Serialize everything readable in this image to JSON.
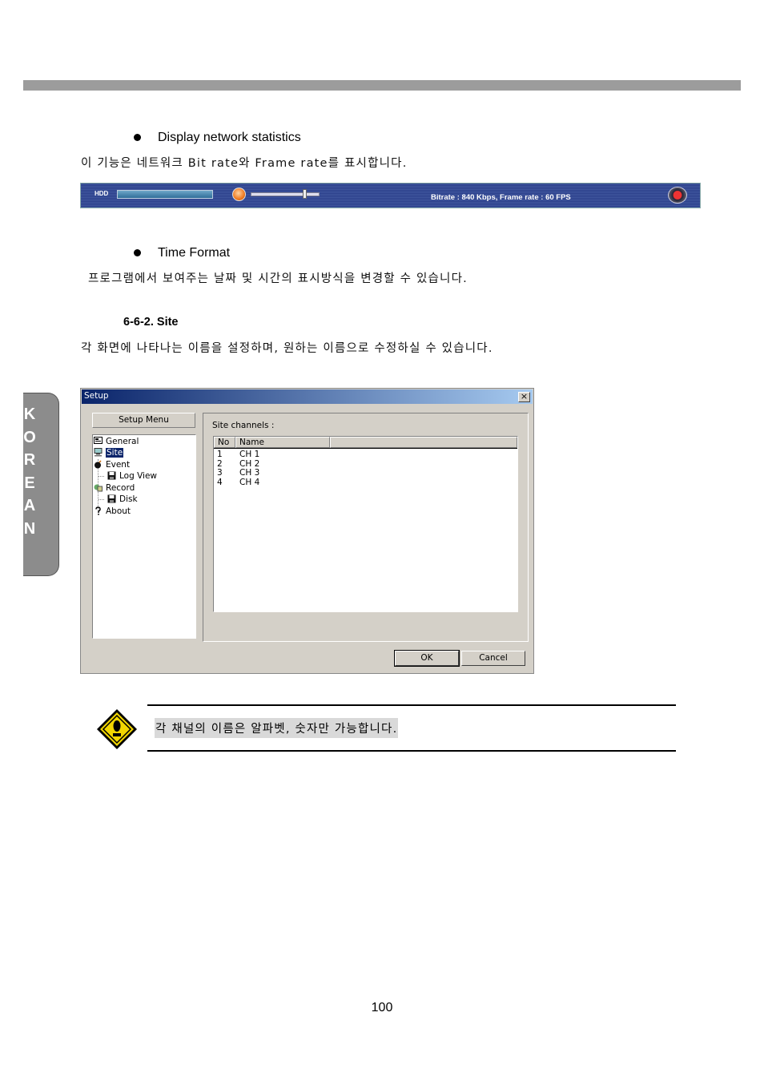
{
  "sections": {
    "network": {
      "title": "Display network statistics",
      "desc": "이 기능은 네트워크 Bit rate와 Frame rate를 표시합니다."
    },
    "statusbar": {
      "hdd_label": "HDD",
      "stats_text": "Bitrate : 840 Kbps, Frame rate : 60 FPS"
    },
    "time": {
      "title": "Time Format",
      "desc": "프로그램에서 보여주는 날짜 및 시간의 표시방식을 변경할 수 있습니다."
    },
    "site": {
      "heading": "6-6-2. Site",
      "desc": "각 화면에 나타나는 이름을 설정하며, 원하는 이름으로 수정하실 수 있습니다."
    }
  },
  "side_tab": [
    "K",
    "O",
    "R",
    "E",
    "A",
    "N"
  ],
  "dialog": {
    "title": "Setup",
    "close_glyph": "×",
    "menu_label": "Setup Menu",
    "tree": [
      "General",
      "Site",
      "Event",
      "Log View",
      "Record",
      "Disk",
      "About"
    ],
    "group_label": "Site channels :",
    "columns": [
      "No",
      "Name"
    ],
    "rows": [
      {
        "no": "1",
        "name": "CH 1"
      },
      {
        "no": "2",
        "name": "CH 2"
      },
      {
        "no": "3",
        "name": "CH 3"
      },
      {
        "no": "4",
        "name": "CH 4"
      }
    ],
    "ok_label": "OK",
    "cancel_label": "Cancel"
  },
  "note": "각 채널의 이름은 알파벳, 숫자만 가능합니다.",
  "page_number": "100",
  "colors": {
    "rule": "#9c9c9c",
    "tab": "#8c8c8c",
    "titlebar_start": "#0a246a",
    "titlebar_end": "#a6caf0",
    "warning": "#f2d600"
  }
}
